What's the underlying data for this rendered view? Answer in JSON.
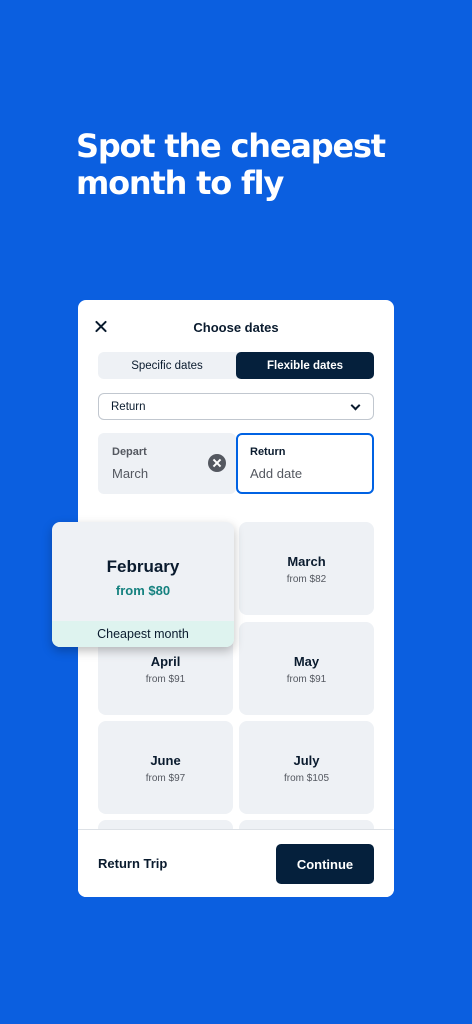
{
  "headline": "Spot the cheapest month to fly",
  "dialog": {
    "title": "Choose dates",
    "tabs": [
      {
        "label": "Specific dates",
        "active": false
      },
      {
        "label": "Flexible dates",
        "active": true
      }
    ],
    "trip_type": "Return",
    "depart": {
      "label": "Depart",
      "value": "March"
    },
    "return": {
      "label": "Return",
      "placeholder": "Add date"
    },
    "featured": {
      "month": "February",
      "price": "from $80",
      "badge": "Cheapest month"
    },
    "months": [
      {
        "month": "March",
        "price": "from $82"
      },
      {
        "month": "April",
        "price": "from $91"
      },
      {
        "month": "May",
        "price": "from $91"
      },
      {
        "month": "June",
        "price": "from $97"
      },
      {
        "month": "July",
        "price": "from $105"
      }
    ],
    "footer": {
      "trip_label": "Return Trip",
      "continue_label": "Continue"
    }
  },
  "colors": {
    "background": "#0b5fe0",
    "primary_button": "#05203c",
    "price_accent": "#15817f",
    "badge_bg": "#def3ef",
    "focus_border": "#0062e3"
  }
}
